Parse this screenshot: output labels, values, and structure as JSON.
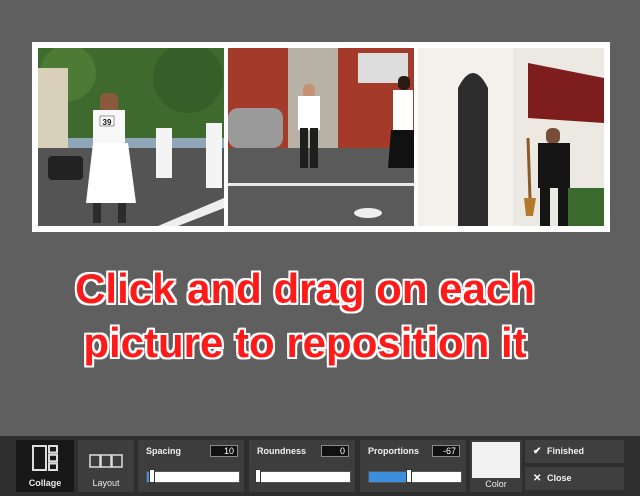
{
  "instruction": {
    "line1": "Click and drag on each",
    "line2": "picture to reposition it"
  },
  "photos": [
    {
      "name": "photo-waiters-race",
      "bib": "39"
    },
    {
      "name": "photo-street-couple"
    },
    {
      "name": "photo-man-with-broom"
    }
  ],
  "toolbar": {
    "collage": {
      "label": "Collage"
    },
    "layout": {
      "label": "Layout"
    },
    "spacing": {
      "label": "Spacing",
      "value": "10",
      "fraction": 0.05
    },
    "roundness": {
      "label": "Roundness",
      "value": "0",
      "fraction": 0.0
    },
    "proportions": {
      "label": "Proportions",
      "value": "-67",
      "fraction": 0.43
    },
    "color": {
      "label": "Color",
      "swatch": "#f2f2f2"
    },
    "finished": {
      "label": "Finished",
      "icon": "check-icon"
    },
    "close": {
      "label": "Close",
      "icon": "close-icon"
    }
  },
  "colors": {
    "background": "#5f5f5f",
    "instruction_text": "#ff1a1a",
    "slider_fill": "#3b8fdc"
  }
}
